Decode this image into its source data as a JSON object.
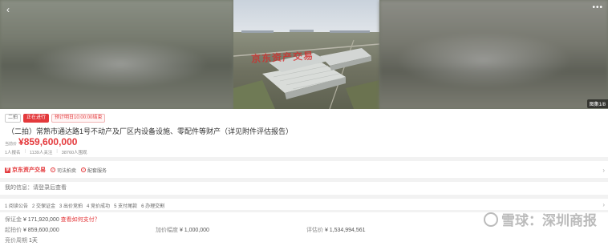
{
  "hero": {
    "back_icon": "chevron-left-icon",
    "more_icon": "more-dots-icon",
    "counter": "图集1/8",
    "photo_watermark": "京东资产交易"
  },
  "status": {
    "round": "二拍",
    "live": "正在进行",
    "end_time": "预计明日10:00:00结束"
  },
  "item": {
    "title": "（二拍）常熟市通达路1号不动产及厂区内设备设施、零配件等财产（详见附件评估报告）",
    "price_label": "当前价",
    "price": "¥859,600,000"
  },
  "stats": {
    "signups": "1人报名",
    "followers": "1139人关注",
    "views": "38760人围观"
  },
  "seller": {
    "logo_mark": "京",
    "name": "京东资产交易",
    "service1": "司法拍卖",
    "service2": "配套服务"
  },
  "info": {
    "text": "我的信息：请登录后查看"
  },
  "steps": [
    "1 阅读公告",
    "2 交保证金",
    "3 出价竞拍",
    "4 竞价成功",
    "5 支付尾款",
    "6 办理交割"
  ],
  "details": {
    "deposit_label": "保证金",
    "deposit_value": "¥ 171,920,000",
    "deposit_link": "查看如何支付？",
    "start_label": "起拍价",
    "start_value": "¥ 859,600,000",
    "increment_label": "加价幅度",
    "increment_value": "¥ 1,000,000",
    "appraisal_label": "评估价",
    "appraisal_value": "¥ 1,534,994,561",
    "cycle_label": "竞价周期",
    "cycle_value": "1天"
  },
  "brand_watermark": "雪球：深圳商报",
  "colors": {
    "accent": "#e4393c"
  }
}
